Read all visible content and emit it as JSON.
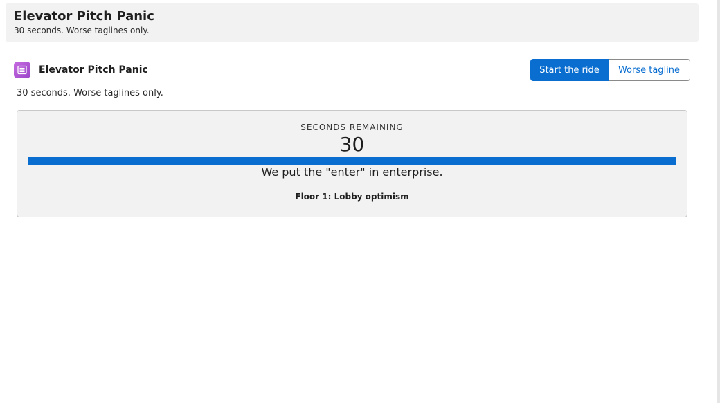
{
  "header": {
    "title": "Elevator Pitch Panic",
    "subtitle": "30 seconds. Worse taglines only."
  },
  "app": {
    "icon": "card-list-icon",
    "icon_color": "#b457d8",
    "title": "Elevator Pitch Panic",
    "subtitle": "30 seconds. Worse taglines only."
  },
  "actions": {
    "start_label": "Start the ride",
    "worse_label": "Worse tagline",
    "primary_color": "#0a6ed1"
  },
  "game": {
    "timer_label": "SECONDS REMAINING",
    "seconds_remaining": "30",
    "progress_fraction": 1.0,
    "tagline": "We put the \"enter\" in enterprise.",
    "floor": "Floor 1: Lobby optimism"
  }
}
